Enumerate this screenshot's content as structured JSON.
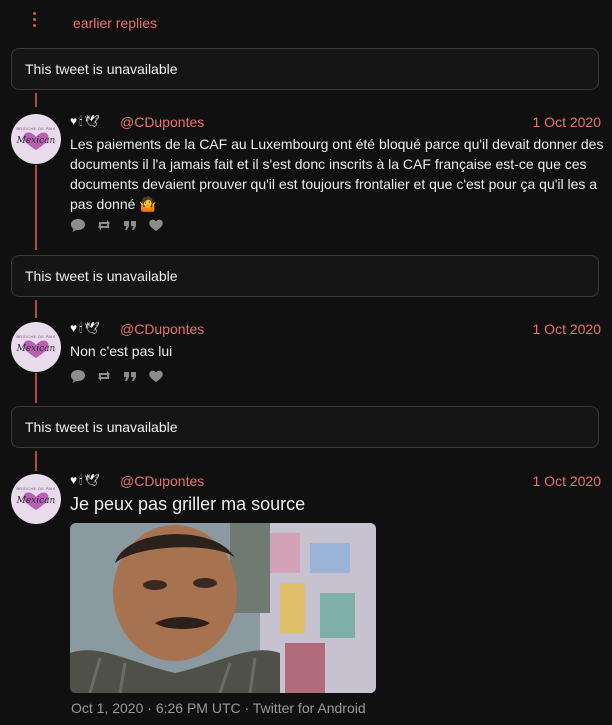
{
  "earlier": {
    "label": "earlier replies"
  },
  "unavailable": [
    {
      "text": "This tweet is unavailable"
    },
    {
      "text": "This tweet is unavailable"
    },
    {
      "text": "This tweet is unavailable"
    }
  ],
  "tweets": [
    {
      "emoji_bar": "♥🕯🕊",
      "handle": "@CDupontes",
      "date": "1 Oct 2020",
      "text": "Les paiements de la CAF au Luxembourg ont été bloqué parce qu'il devait donner des documents il l'a jamais fait et il s'est donc inscrits à la CAF française est-ce que ces documents devaient prouver qu'il est toujours frontalier et que c'est pour ça qu'il les a pas donné 🤷",
      "actions": [
        "reply-icon",
        "retweet-icon",
        "quote-icon",
        "like-icon"
      ]
    },
    {
      "emoji_bar": "♥🕯🕊",
      "handle": "@CDupontes",
      "date": "1 Oct 2020",
      "text": "Non c'est pas lui",
      "actions": [
        "reply-icon",
        "retweet-icon",
        "quote-icon",
        "like-icon"
      ]
    },
    {
      "emoji_bar": "♥🕯🕊",
      "handle": "@CDupontes",
      "date": "1 Oct 2020",
      "text": "Je peux pas griller ma source",
      "footer": "Oct 1, 2020 · 6:26 PM UTC · Twitter for Android"
    }
  ],
  "avatar": {
    "top_text": "BRIOCHE DE PAIX",
    "script_text": "Mexican"
  },
  "colors": {
    "accent": "#e8736e",
    "thread_line": "#b14a4a",
    "background": "#101010",
    "card_border": "#3a3a3a"
  }
}
